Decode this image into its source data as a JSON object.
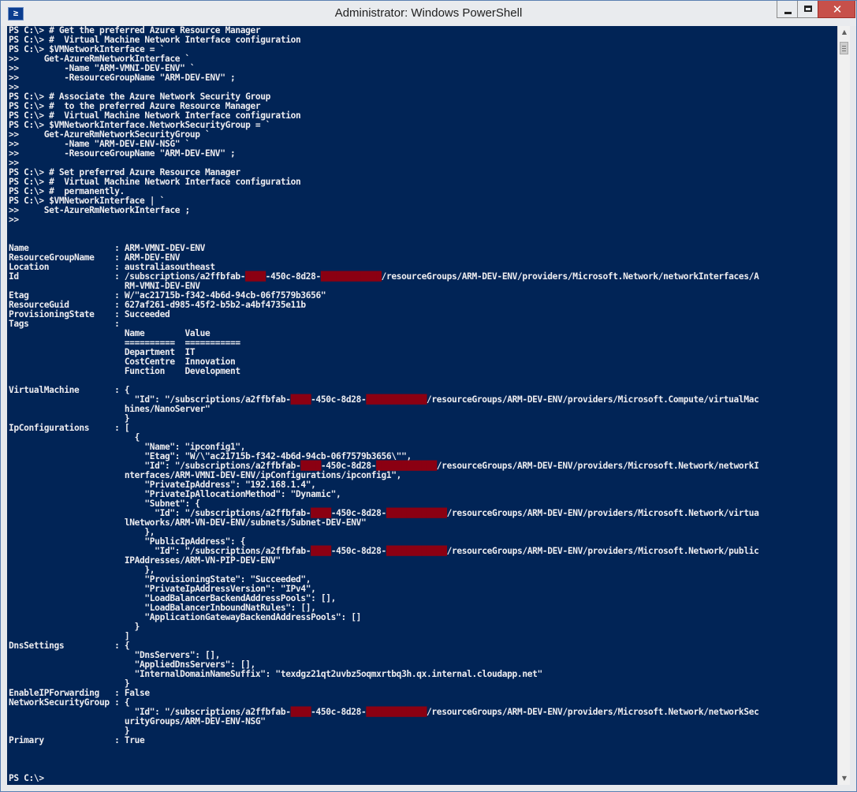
{
  "window": {
    "title": "Administrator: Windows PowerShell",
    "close_glyph": "✕",
    "app_icon_glyph": "≥"
  },
  "colors": {
    "console_bg": "#012456",
    "console_fg": "#eeedf0",
    "redaction": "#8b0012",
    "close_button": "#c7504a"
  },
  "console": {
    "lines": [
      "PS C:\\> # Get the preferred Azure Resource Manager",
      "PS C:\\> #  Virtual Machine Network Interface configuration",
      "PS C:\\> $VMNetworkInterface = `",
      ">>     Get-AzureRmNetworkInterface `",
      ">>         -Name \"ARM-VMNI-DEV-ENV\" `",
      ">>         -ResourceGroupName \"ARM-DEV-ENV\" ;",
      ">>",
      "PS C:\\> # Associate the Azure Network Security Group",
      "PS C:\\> #  to the preferred Azure Resource Manager",
      "PS C:\\> #  Virtual Machine Network Interface configuration",
      "PS C:\\> $VMNetworkInterface.NetworkSecurityGroup = `",
      ">>     Get-AzureRmNetworkSecurityGroup `",
      ">>         -Name \"ARM-DEV-ENV-NSG\" `",
      ">>         -ResourceGroupName \"ARM-DEV-ENV\" ;",
      ">>",
      "PS C:\\> # Set preferred Azure Resource Manager",
      "PS C:\\> #  Virtual Machine Network Interface configuration",
      "PS C:\\> #  permanently.",
      "PS C:\\> $VMNetworkInterface | `",
      ">>     Set-AzureRmNetworkInterface ;",
      ">>",
      "",
      "",
      "Name                 : ARM-VMNI-DEV-ENV",
      "ResourceGroupName    : ARM-DEV-ENV",
      "Location             : australiasoutheast",
      "Id                   : /subscriptions/a2ffbfab-████-450c-8d28-████████████/resourceGroups/ARM-DEV-ENV/providers/Microsoft.Network/networkInterfaces/A",
      "                       RM-VMNI-DEV-ENV",
      "Etag                 : W/\"ac21715b-f342-4b6d-94cb-06f7579b3656\"",
      "ResourceGuid         : 627af261-d985-45f2-b5b2-a4bf4735e11b",
      "ProvisioningState    : Succeeded",
      "Tags                 :",
      "                       Name        Value",
      "                       ==========  ===========",
      "                       Department  IT",
      "                       CostCentre  Innovation",
      "                       Function    Development",
      "",
      "VirtualMachine       : {",
      "                         \"Id\": \"/subscriptions/a2ffbfab-████-450c-8d28-████████████/resourceGroups/ARM-DEV-ENV/providers/Microsoft.Compute/virtualMac",
      "                       hines/NanoServer\"",
      "                       }",
      "IpConfigurations     : [",
      "                         {",
      "                           \"Name\": \"ipconfig1\",",
      "                           \"Etag\": \"W/\\\"ac21715b-f342-4b6d-94cb-06f7579b3656\\\"\",",
      "                           \"Id\": \"/subscriptions/a2ffbfab-████-450c-8d28-████████████/resourceGroups/ARM-DEV-ENV/providers/Microsoft.Network/networkI",
      "                       nterfaces/ARM-VMNI-DEV-ENV/ipConfigurations/ipconfig1\",",
      "                           \"PrivateIpAddress\": \"192.168.1.4\",",
      "                           \"PrivateIpAllocationMethod\": \"Dynamic\",",
      "                           \"Subnet\": {",
      "                             \"Id\": \"/subscriptions/a2ffbfab-████-450c-8d28-████████████/resourceGroups/ARM-DEV-ENV/providers/Microsoft.Network/virtua",
      "                       lNetworks/ARM-VN-DEV-ENV/subnets/Subnet-DEV-ENV\"",
      "                           },",
      "                           \"PublicIpAddress\": {",
      "                             \"Id\": \"/subscriptions/a2ffbfab-████-450c-8d28-████████████/resourceGroups/ARM-DEV-ENV/providers/Microsoft.Network/public",
      "                       IPAddresses/ARM-VN-PIP-DEV-ENV\"",
      "                           },",
      "                           \"ProvisioningState\": \"Succeeded\",",
      "                           \"PrivateIpAddressVersion\": \"IPv4\",",
      "                           \"LoadBalancerBackendAddressPools\": [],",
      "                           \"LoadBalancerInboundNatRules\": [],",
      "                           \"ApplicationGatewayBackendAddressPools\": []",
      "                         }",
      "                       ]",
      "DnsSettings          : {",
      "                         \"DnsServers\": [],",
      "                         \"AppliedDnsServers\": [],",
      "                         \"InternalDomainNameSuffix\": \"texdgz21qt2uvbz5oqmxrtbq3h.qx.internal.cloudapp.net\"",
      "                       }",
      "EnableIPForwarding   : False",
      "NetworkSecurityGroup : {",
      "                         \"Id\": \"/subscriptions/a2ffbfab-████-450c-8d28-████████████/resourceGroups/ARM-DEV-ENV/providers/Microsoft.Network/networkSec",
      "                       urityGroups/ARM-DEV-ENV-NSG\"",
      "                       }",
      "Primary              : True",
      "",
      "",
      "",
      "PS C:\\>"
    ]
  },
  "scrollbar": {
    "up_glyph": "▲",
    "down_glyph": "▼"
  }
}
